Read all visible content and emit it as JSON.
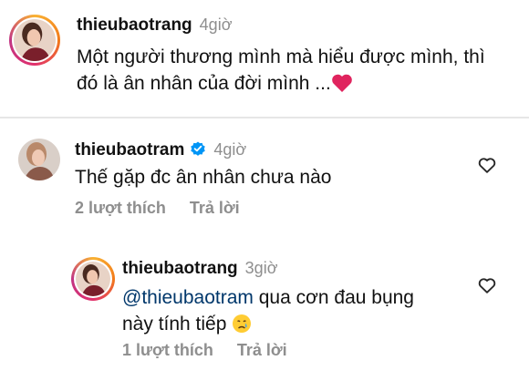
{
  "caption": {
    "username": "thieubaotrang",
    "time": "4giờ",
    "text_line1": "Một người thương mình mà hiểu được mình, thì",
    "text_line2": "đó là ân nhân của đời mình ...",
    "emoji": "red-heart-emoji"
  },
  "comments": [
    {
      "username": "thieubaotram",
      "verified": true,
      "time": "4giờ",
      "text": "Thế gặp đc ân nhân chưa nào",
      "likes": "2 lượt thích",
      "reply_label": "Trả lời",
      "like_icon": "heart-outline-icon"
    }
  ],
  "reply": {
    "username": "thieubaotrang",
    "time": "3giờ",
    "mention": "@thieubaotram",
    "text_line1": " qua cơn đau bụng",
    "text_line2": "này tính tiếp",
    "emoji": "crying-face-emoji",
    "likes": "1 lượt thích",
    "reply_label": "Trả lời",
    "like_icon": "heart-outline-icon"
  },
  "colors": {
    "username": "#111111",
    "muted": "#8e8e8e",
    "mention": "#00376b",
    "verified": "#0095f6",
    "heart": "#e0245e"
  }
}
